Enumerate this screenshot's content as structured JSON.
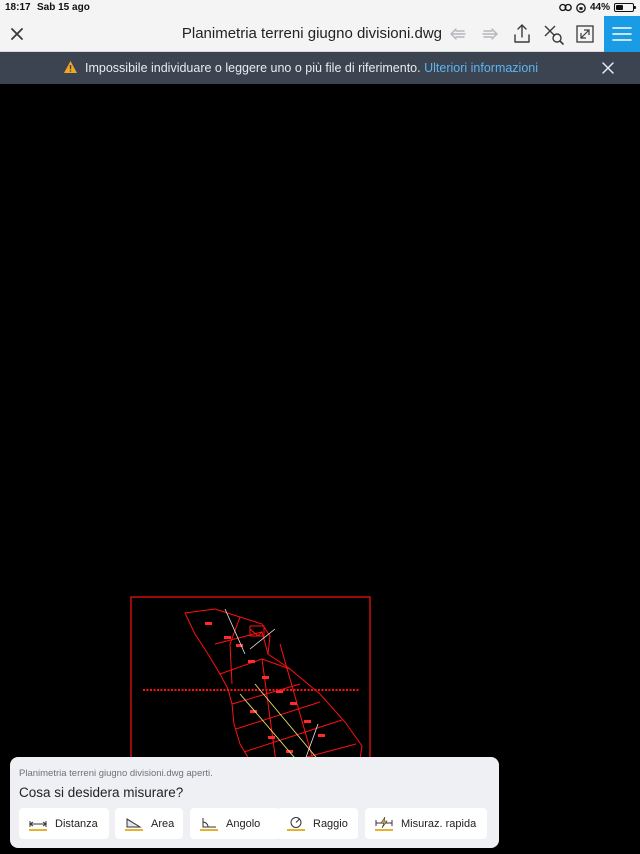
{
  "status_bar": {
    "time": "18:17",
    "date": "Sab 15 ago",
    "battery": "44%",
    "battery_level": 0.44
  },
  "toolbar": {
    "title": "Planimetria terreni giugno divisioni.dwg",
    "icons": [
      "close-icon",
      "undo-icon",
      "redo-icon",
      "share-icon",
      "measure-tool-icon",
      "fullscreen-icon",
      "menu-icon"
    ]
  },
  "warning": {
    "message": "Impossibile individuare o leggere uno o più file di riferimento.",
    "link": "Ulteriori informazioni"
  },
  "measure_panel": {
    "status": "Planimetria terreni giugno divisioni.dwg aperti.",
    "question": "Cosa si desidera misurare?",
    "buttons": [
      "Distanza",
      "Area",
      "Angolo",
      "Raggio",
      "Misuraz. rapida"
    ]
  },
  "colors": {
    "accent": "#1a9be6",
    "warning_bg": "#3b4450",
    "link": "#5eb5f0",
    "drawing_red": "#ff1010",
    "drawing_yellow": "#e8e070"
  }
}
